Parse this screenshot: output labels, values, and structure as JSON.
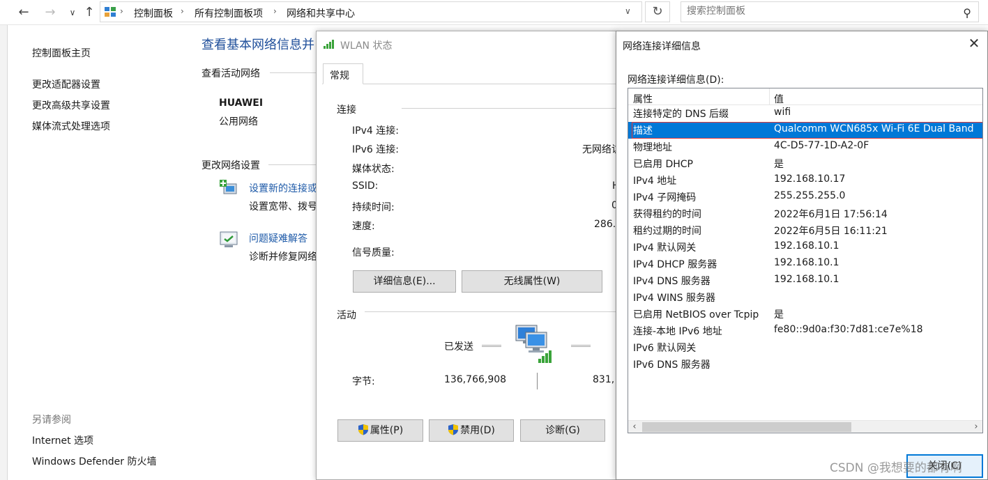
{
  "address_bar": {
    "breadcrumbs": [
      "控制面板",
      "所有控制面板项",
      "网络和共享中心"
    ],
    "search_placeholder": "搜索控制面板"
  },
  "left_nav": {
    "items": [
      "控制面板主页",
      "更改适配器设置",
      "更改高级共享设置",
      "媒体流式处理选项"
    ],
    "see_also_title": "另请参阅",
    "see_also": [
      "Internet 选项",
      "Windows Defender 防火墙"
    ]
  },
  "main": {
    "title": "查看基本网络信息并",
    "active_networks_header": "查看活动网络",
    "network_name": "HUAWEI",
    "network_type": "公用网络",
    "change_settings_header": "更改网络设置",
    "tasks": [
      {
        "link": "设置新的连接或",
        "desc": "设置宽带、拨号"
      },
      {
        "link": "问题疑难解答",
        "desc": "诊断并修复网络"
      }
    ]
  },
  "wlan_status": {
    "title": "WLAN 状态",
    "tab": "常规",
    "connection_header": "连接",
    "rows": [
      {
        "label": "IPv4 连接:",
        "value": ""
      },
      {
        "label": "IPv6 连接:",
        "value": "无网络访"
      },
      {
        "label": "媒体状态:",
        "value": ""
      },
      {
        "label": "SSID:",
        "value": "H"
      },
      {
        "label": "持续时间:",
        "value": "0"
      },
      {
        "label": "速度:",
        "value": "286."
      }
    ],
    "signal_label": "信号质量:",
    "details_button": "详细信息(E)...",
    "wireless_props_button": "无线属性(W)",
    "activity_header": "活动",
    "sent_label": "已发送",
    "bytes_label": "字节:",
    "bytes_sent": "136,766,908",
    "bytes_received": "831,",
    "properties_button": "属性(P)",
    "disable_button": "禁用(D)",
    "diagnose_button": "诊断(G)"
  },
  "details_dialog": {
    "title": "网络连接详细信息",
    "list_label": "网络连接详细信息(D):",
    "col_property": "属性",
    "col_value": "值",
    "rows": [
      {
        "p": "连接特定的 DNS 后缀",
        "v": "wifi"
      },
      {
        "p": "描述",
        "v": "Qualcomm WCN685x Wi-Fi 6E Dual Band"
      },
      {
        "p": "物理地址",
        "v": "4C-D5-77-1D-A2-0F"
      },
      {
        "p": "已启用 DHCP",
        "v": "是"
      },
      {
        "p": "IPv4 地址",
        "v": "192.168.10.17"
      },
      {
        "p": "IPv4 子网掩码",
        "v": "255.255.255.0"
      },
      {
        "p": "获得租约的时间",
        "v": "2022年6月1日 17:56:14"
      },
      {
        "p": "租约过期的时间",
        "v": "2022年6月5日 16:11:21"
      },
      {
        "p": "IPv4 默认网关",
        "v": "192.168.10.1"
      },
      {
        "p": "IPv4 DHCP 服务器",
        "v": "192.168.10.1"
      },
      {
        "p": "IPv4 DNS 服务器",
        "v": "192.168.10.1"
      },
      {
        "p": "IPv4 WINS 服务器",
        "v": ""
      },
      {
        "p": "已启用 NetBIOS over Tcpip",
        "v": "是"
      },
      {
        "p": "连接-本地 IPv6 地址",
        "v": "fe80::9d0a:f30:7d81:ce7e%18"
      },
      {
        "p": "IPv6 默认网关",
        "v": ""
      },
      {
        "p": "IPv6 DNS 服务器",
        "v": ""
      }
    ],
    "selected_index": 1,
    "close_button": "关闭(C)"
  },
  "watermark": "CSDN @我想要的都有啊"
}
